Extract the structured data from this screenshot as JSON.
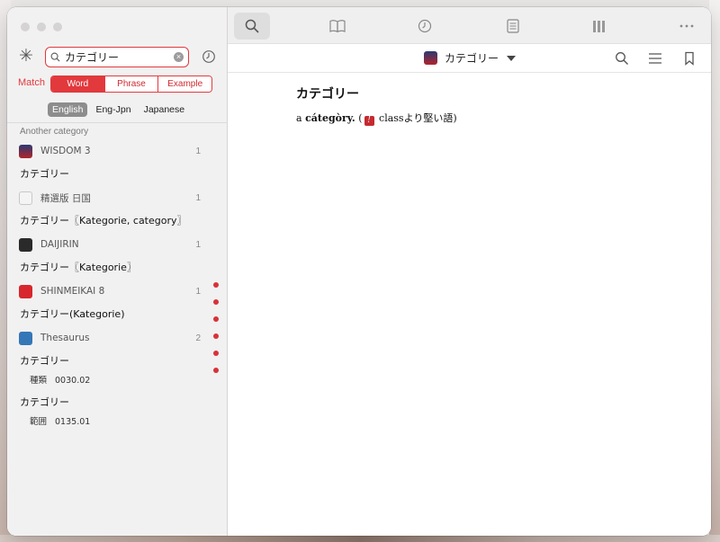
{
  "sidebar": {
    "search": {
      "value": "カテゴリー"
    },
    "match_label": "Match",
    "match_options": [
      "Word",
      "Phrase",
      "Example"
    ],
    "match_selected": "Word",
    "languages": [
      "English",
      "Eng-Jpn",
      "Japanese"
    ],
    "language_selected": "English",
    "section_header": "Another category",
    "results": [
      {
        "dict": "WISDOM 3",
        "count": "1",
        "icon": "wisdom-dict-icon",
        "entries": [
          "カテゴリー"
        ]
      },
      {
        "dict": "精選版 日国",
        "count": "1",
        "icon": "seisen-dict-icon",
        "entries": [
          "カテゴリー〖Kategorie, category〗"
        ]
      },
      {
        "dict": "DAIJIRIN",
        "count": "1",
        "icon": "daijirin-dict-icon",
        "entries": [
          "カテゴリー〖Kategorie〗"
        ]
      },
      {
        "dict": "SHINMEIKAI 8",
        "count": "1",
        "icon": "shinmeikai-dict-icon",
        "entries": [
          "カテゴリー(Kategorie)"
        ]
      },
      {
        "dict": "Thesaurus",
        "count": "2",
        "icon": "thesaurus-dict-icon",
        "entries": [
          {
            "word": "カテゴリー",
            "sub": [
              "種類",
              "0030.02"
            ]
          },
          {
            "word": "カテゴリー",
            "sub": [
              "範囲",
              "0135.01"
            ]
          }
        ]
      }
    ]
  },
  "toolbar": {
    "buttons": [
      "search-icon",
      "book-icon",
      "history-icon",
      "notes-icon",
      "library-icon",
      "more-icon"
    ],
    "active": "search-icon"
  },
  "main": {
    "current_dict": "カテゴリー",
    "headword": "カテゴリー",
    "definition": {
      "prefix": "a ",
      "word": "cátegòry.",
      "open": " (",
      "note_icon": "!",
      "note": " classより堅い語)"
    }
  },
  "colors": {
    "accent": "#e2393d",
    "sidebar_bg": "#f2f1f1",
    "dot": "#d8313a"
  }
}
